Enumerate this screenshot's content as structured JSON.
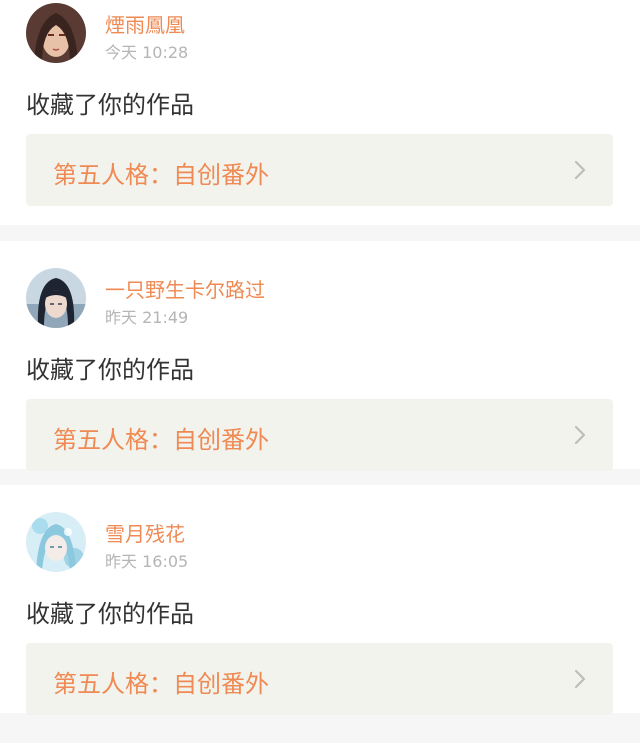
{
  "notifications": [
    {
      "username": "煙雨鳳凰",
      "timestamp": "今天 10:28",
      "action": "收藏了你的作品",
      "work_title": "第五人格：自创番外",
      "avatar_icon": "anime-avatar-brown"
    },
    {
      "username": "一只野生卡尔路过",
      "timestamp": "昨天 21:49",
      "action": "收藏了你的作品",
      "work_title": "第五人格：自创番外",
      "avatar_icon": "anime-avatar-dark"
    },
    {
      "username": "雪月残花",
      "timestamp": "昨天 16:05",
      "action": "收藏了你的作品",
      "work_title": "第五人格：自创番外",
      "avatar_icon": "anime-avatar-light-blue"
    }
  ],
  "colors": {
    "accent": "#ef8a54",
    "card_bg": "#f3f3ed",
    "text": "#333333",
    "muted": "#b5b5b5",
    "page_bg": "#f6f6f6"
  }
}
